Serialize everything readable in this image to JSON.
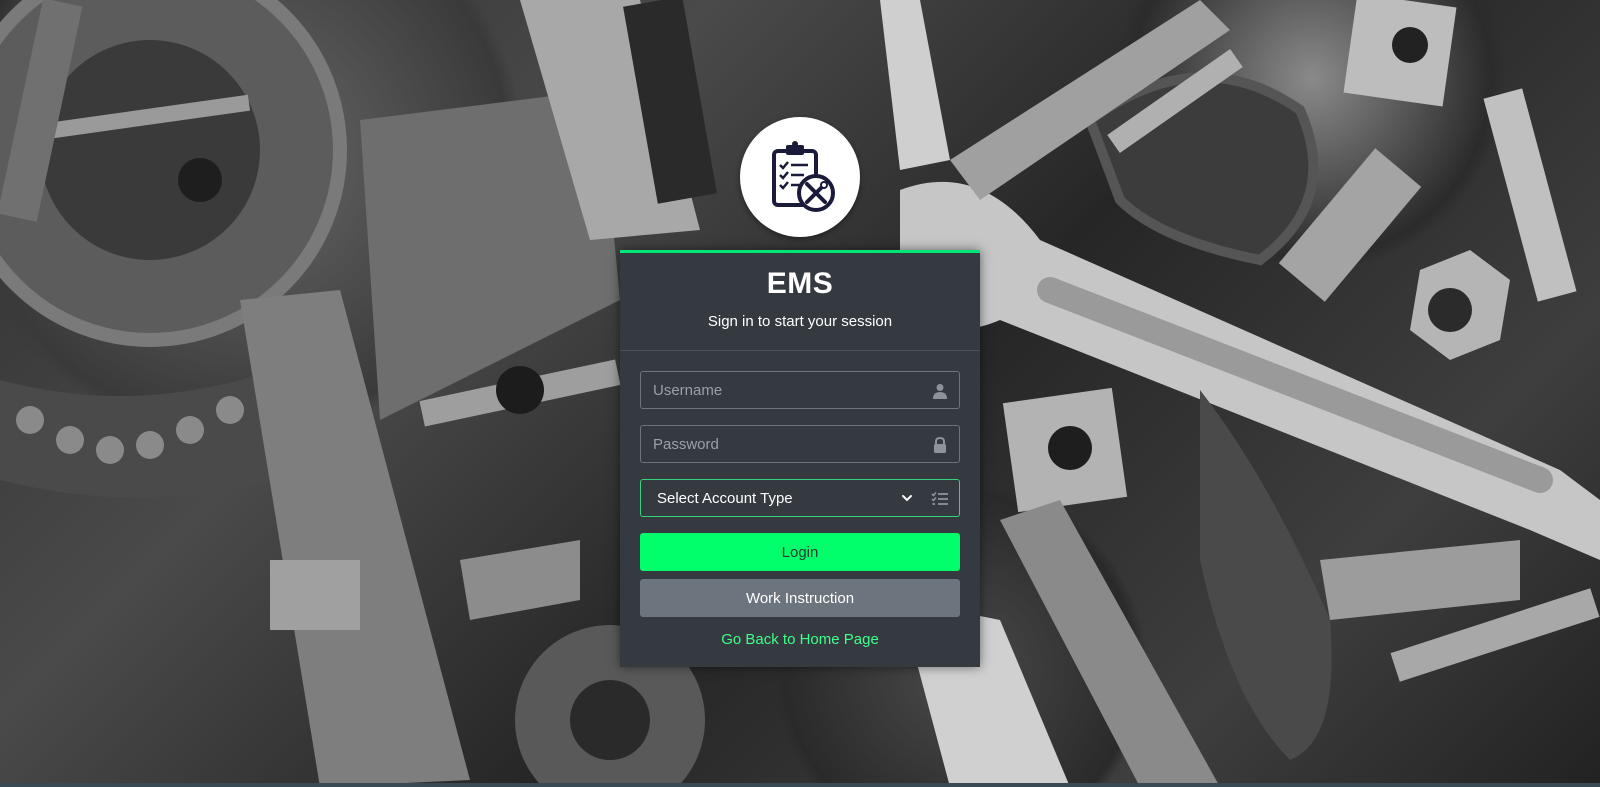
{
  "app": {
    "title": "EMS",
    "subtitle": "Sign in to start your session"
  },
  "form": {
    "username": {
      "placeholder": "Username",
      "value": "",
      "icon": "user-icon"
    },
    "password": {
      "placeholder": "Password",
      "value": "",
      "icon": "lock-icon"
    },
    "account_type": {
      "selected": "Select Account Type",
      "icon": "list-check-icon"
    }
  },
  "buttons": {
    "login": "Login",
    "work_instruction": "Work Instruction"
  },
  "links": {
    "home": "Go Back to Home Page"
  },
  "colors": {
    "accent": "#00ff6a",
    "card": "#343a40",
    "secondary": "#6c757d",
    "link": "#3dff8a"
  }
}
